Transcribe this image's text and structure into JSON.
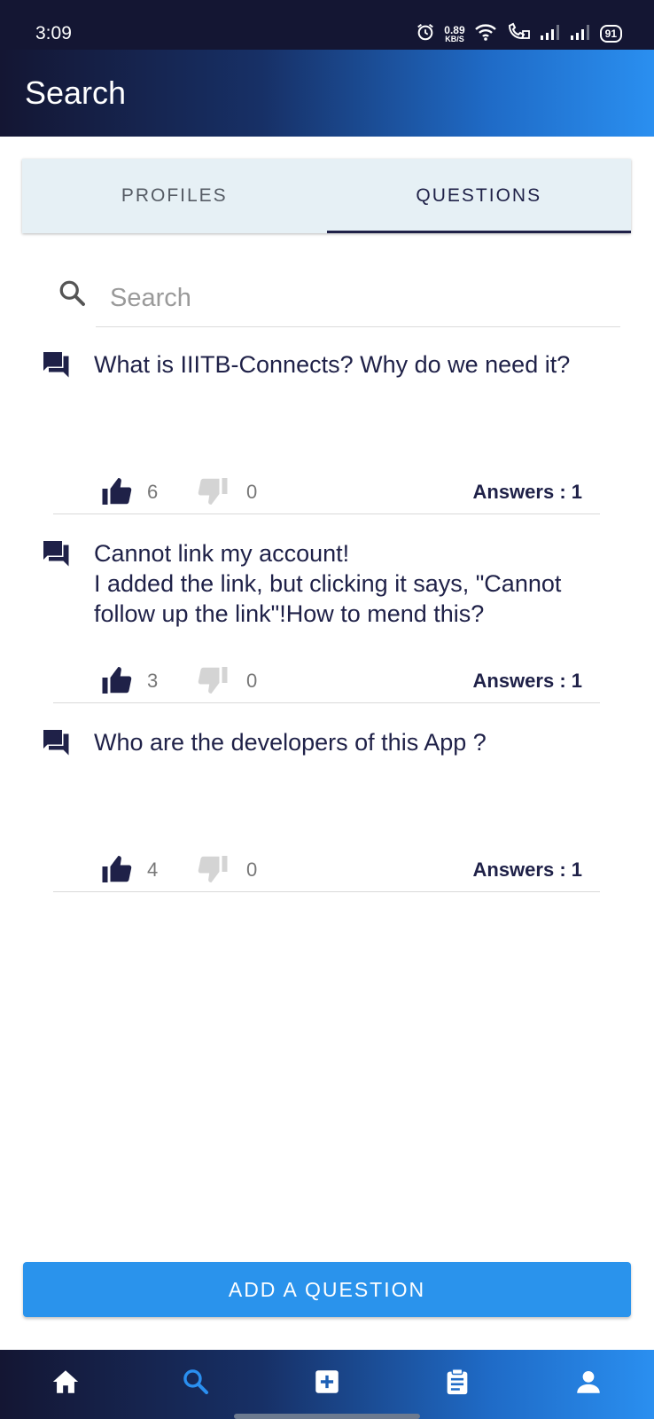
{
  "status_bar": {
    "time": "3:09",
    "net_speed_value": "0.89",
    "net_speed_unit": "KB/S",
    "battery": "91",
    "icons": [
      "alarm-icon",
      "wifi-icon",
      "volte-call-icon",
      "signal-icon",
      "signal-icon",
      "battery-icon"
    ]
  },
  "header": {
    "title": "Search"
  },
  "tabs": [
    {
      "label": "PROFILES",
      "active": false
    },
    {
      "label": "QUESTIONS",
      "active": true
    }
  ],
  "search": {
    "placeholder": "Search",
    "value": ""
  },
  "questions": [
    {
      "text": "What is IIITB-Connects? Why do we need it?",
      "upvotes": "6",
      "downvotes": "0",
      "answers": "Answers : 1"
    },
    {
      "text": "Cannot link my account!\nI added the link, but clicking it says, \"Cannot follow up the link\"!How to mend this?",
      "upvotes": "3",
      "downvotes": "0",
      "answers": "Answers : 1"
    },
    {
      "text": "Who are the developers of this App ?",
      "upvotes": "4",
      "downvotes": "0",
      "answers": "Answers : 1"
    }
  ],
  "add_button": {
    "label": "ADD A QUESTION"
  },
  "bottom_nav": {
    "items": [
      {
        "icon": "home-icon",
        "active": false
      },
      {
        "icon": "search-icon",
        "active": true
      },
      {
        "icon": "add-box-icon",
        "active": false
      },
      {
        "icon": "clipboard-icon",
        "active": false
      },
      {
        "icon": "person-icon",
        "active": false
      }
    ],
    "active_color": "#2a8ff0"
  },
  "colors": {
    "primary_dark": "#1f2148",
    "accent": "#2a93ec",
    "tab_bg": "#e6f0f5"
  }
}
